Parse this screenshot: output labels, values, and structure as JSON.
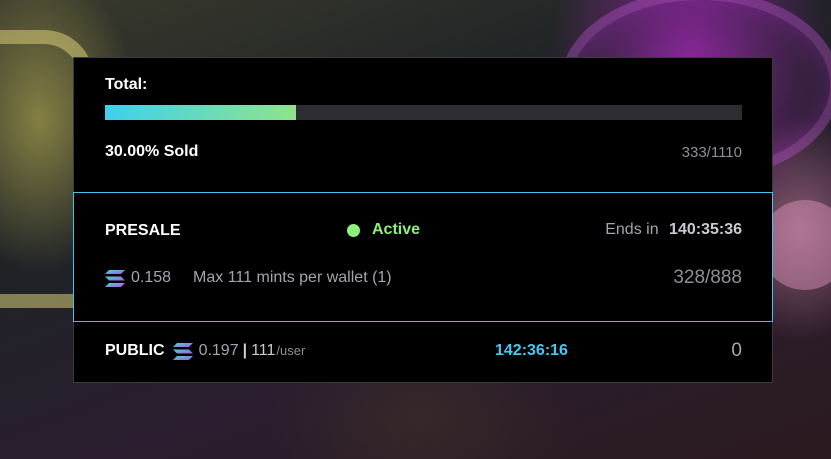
{
  "total": {
    "label": "Total:",
    "progress_percent": 30,
    "sold_text": "30.00% Sold",
    "count": "333/1110"
  },
  "presale": {
    "name": "PRESALE",
    "status": "Active",
    "ends_label": "Ends in",
    "ends_time": "140:35:36",
    "price": "0.158",
    "max_text": "Max 111 mints per wallet (1)",
    "count": "328/888",
    "icon": "solana-icon"
  },
  "public": {
    "name": "PUBLIC",
    "price": "0.197",
    "separator": "|",
    "limit": "111",
    "per_user": "/user",
    "time": "142:36:16",
    "count": "0",
    "icon": "solana-icon"
  },
  "colors": {
    "accent_cyan": "#41c3ea",
    "active_green": "#8ff07a",
    "progress_start": "#3fd0ee",
    "progress_end": "#8fe38c"
  }
}
